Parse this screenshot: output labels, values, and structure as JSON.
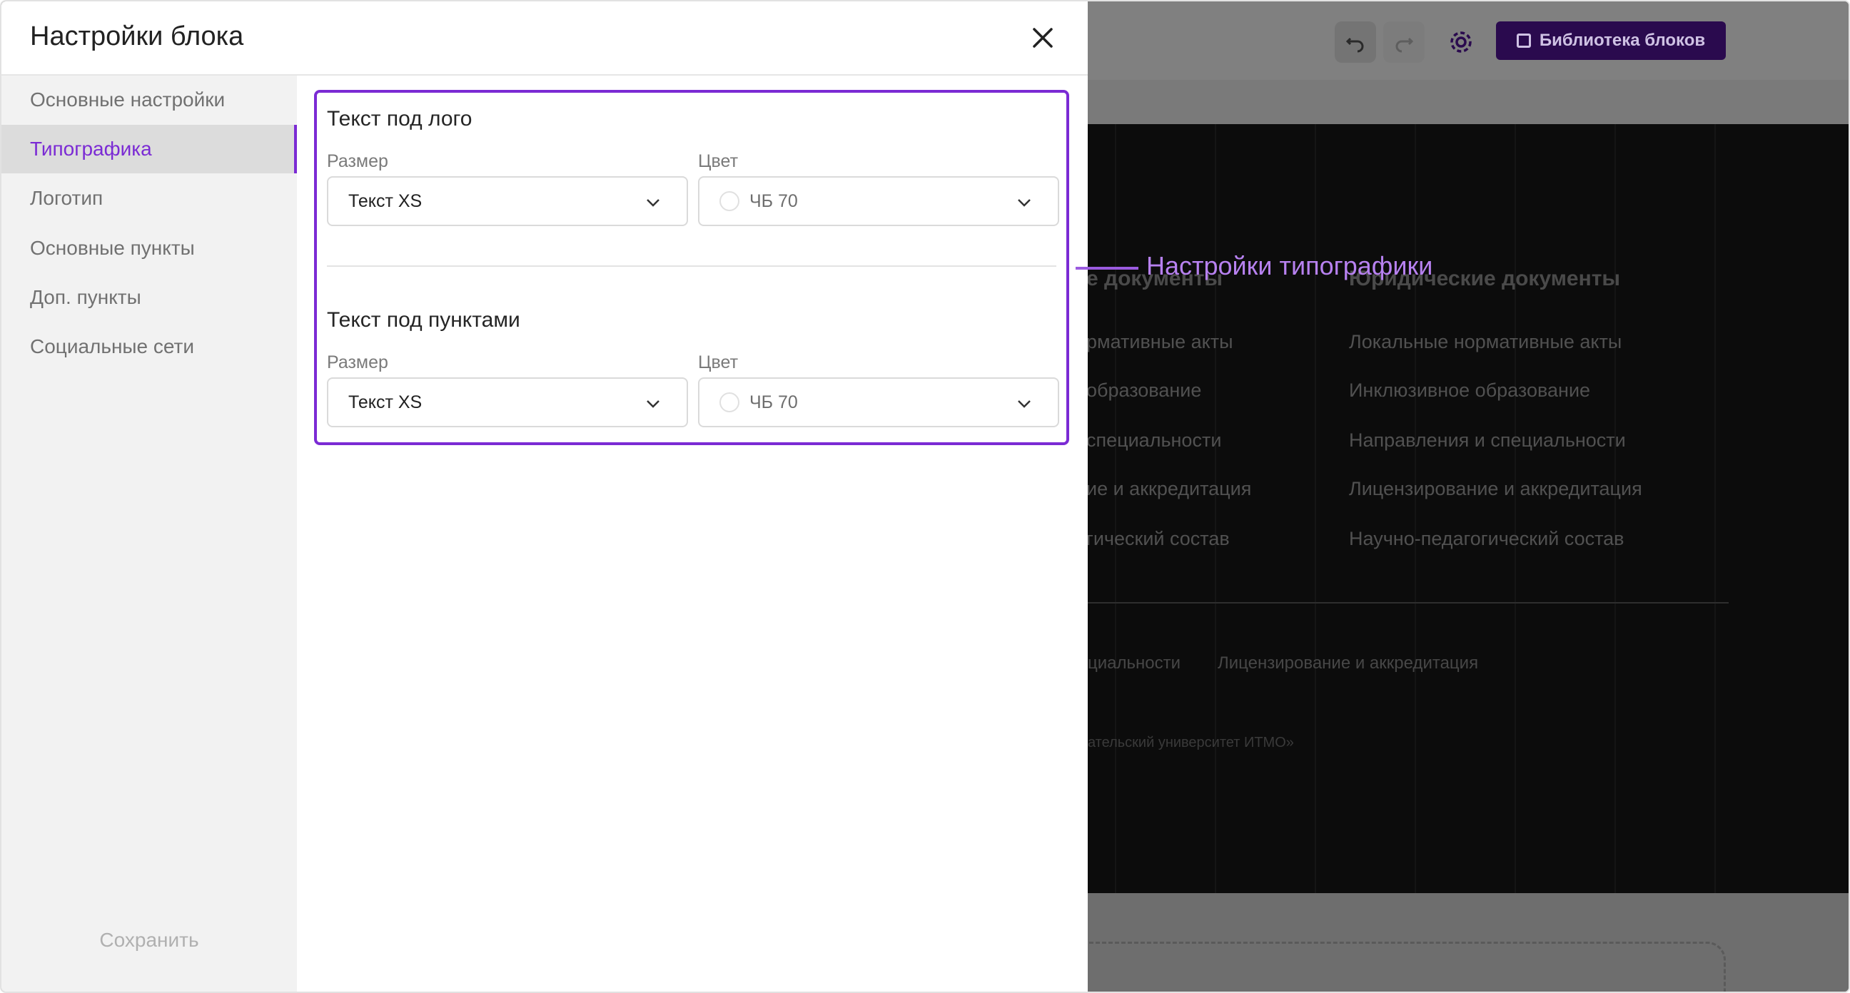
{
  "background": {
    "library_button": "Библиотека блоков",
    "columns": [
      {
        "heading": "е документы",
        "items": [
          "рмативные акты",
          "образование",
          "специальности",
          "ие и аккредитация",
          "гический состав"
        ]
      },
      {
        "heading": "Юридические документы",
        "items": [
          "Локальные нормативные акты",
          "Инклюзивное образование",
          "Направления и специальности",
          "Лицензирование и аккредитация",
          "Научно-педагогический состав"
        ]
      }
    ],
    "bottom_links": [
      "циальности",
      "Лицензирование и аккредитация"
    ],
    "copyright": "ательский университет ИТМО»"
  },
  "modal": {
    "title": "Настройки блока",
    "nav": [
      {
        "label": "Основные настройки",
        "active": false
      },
      {
        "label": "Типографика",
        "active": true
      },
      {
        "label": "Логотип",
        "active": false
      },
      {
        "label": "Основные пункты",
        "active": false
      },
      {
        "label": "Доп. пункты",
        "active": false
      },
      {
        "label": "Социальные сети",
        "active": false
      }
    ],
    "save_label": "Сохранить",
    "sections": [
      {
        "title": "Текст под лого",
        "size_label": "Размер",
        "size_value": "Текст XS",
        "color_label": "Цвет",
        "color_value": "ЧБ 70"
      },
      {
        "title": "Текст под пунктами",
        "size_label": "Размер",
        "size_value": "Текст XS",
        "color_label": "Цвет",
        "color_value": "ЧБ 70"
      }
    ]
  },
  "annotation": "Настройки типографики",
  "colors": {
    "accent": "#7b2bd4",
    "annotation": "#b781f0"
  },
  "icons": [
    "undo-icon",
    "redo-icon",
    "gear-icon",
    "library-icon",
    "close-icon",
    "chevron-down-icon",
    "color-swatch-icon"
  ]
}
